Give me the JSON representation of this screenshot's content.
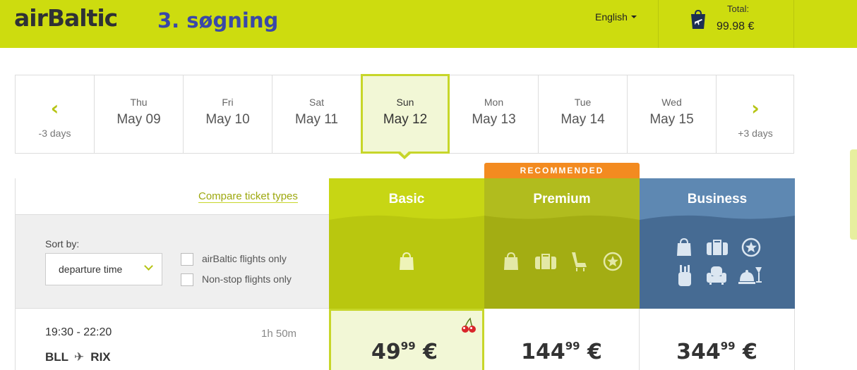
{
  "header": {
    "logo": "airBaltic",
    "annotation": "3. søgning",
    "language": "English",
    "total_label": "Total:",
    "total_value": "99.98 €"
  },
  "dates": {
    "prev_label": "-3 days",
    "next_label": "+3 days",
    "days": [
      {
        "dow": "Thu",
        "date": "May 09"
      },
      {
        "dow": "Fri",
        "date": "May 10"
      },
      {
        "dow": "Sat",
        "date": "May 11"
      },
      {
        "dow": "Sun",
        "date": "May 12"
      },
      {
        "dow": "Mon",
        "date": "May 13"
      },
      {
        "dow": "Tue",
        "date": "May 14"
      },
      {
        "dow": "Wed",
        "date": "May 15"
      }
    ],
    "selected_index": 3
  },
  "fares": {
    "compare_link": "Compare ticket types",
    "recommended": "RECOMMENDED",
    "columns": [
      "Basic",
      "Premium",
      "Business"
    ]
  },
  "filters": {
    "sort_label": "Sort by:",
    "sort_value": "departure time",
    "checkbox_1": "airBaltic flights only",
    "checkbox_2": "Non-stop flights only"
  },
  "flight": {
    "time": "19:30 - 22:20",
    "duration": "1h 50m",
    "from": "BLL",
    "to": "RIX",
    "prices": [
      {
        "int": "49",
        "dec": "99",
        "cur": "€"
      },
      {
        "int": "144",
        "dec": "99",
        "cur": "€"
      },
      {
        "int": "344",
        "dec": "99",
        "cur": "€"
      }
    ]
  },
  "colors": {
    "brand": "#cddc0f",
    "accent_orange": "#f38b20",
    "business_blue": "#466b93"
  }
}
